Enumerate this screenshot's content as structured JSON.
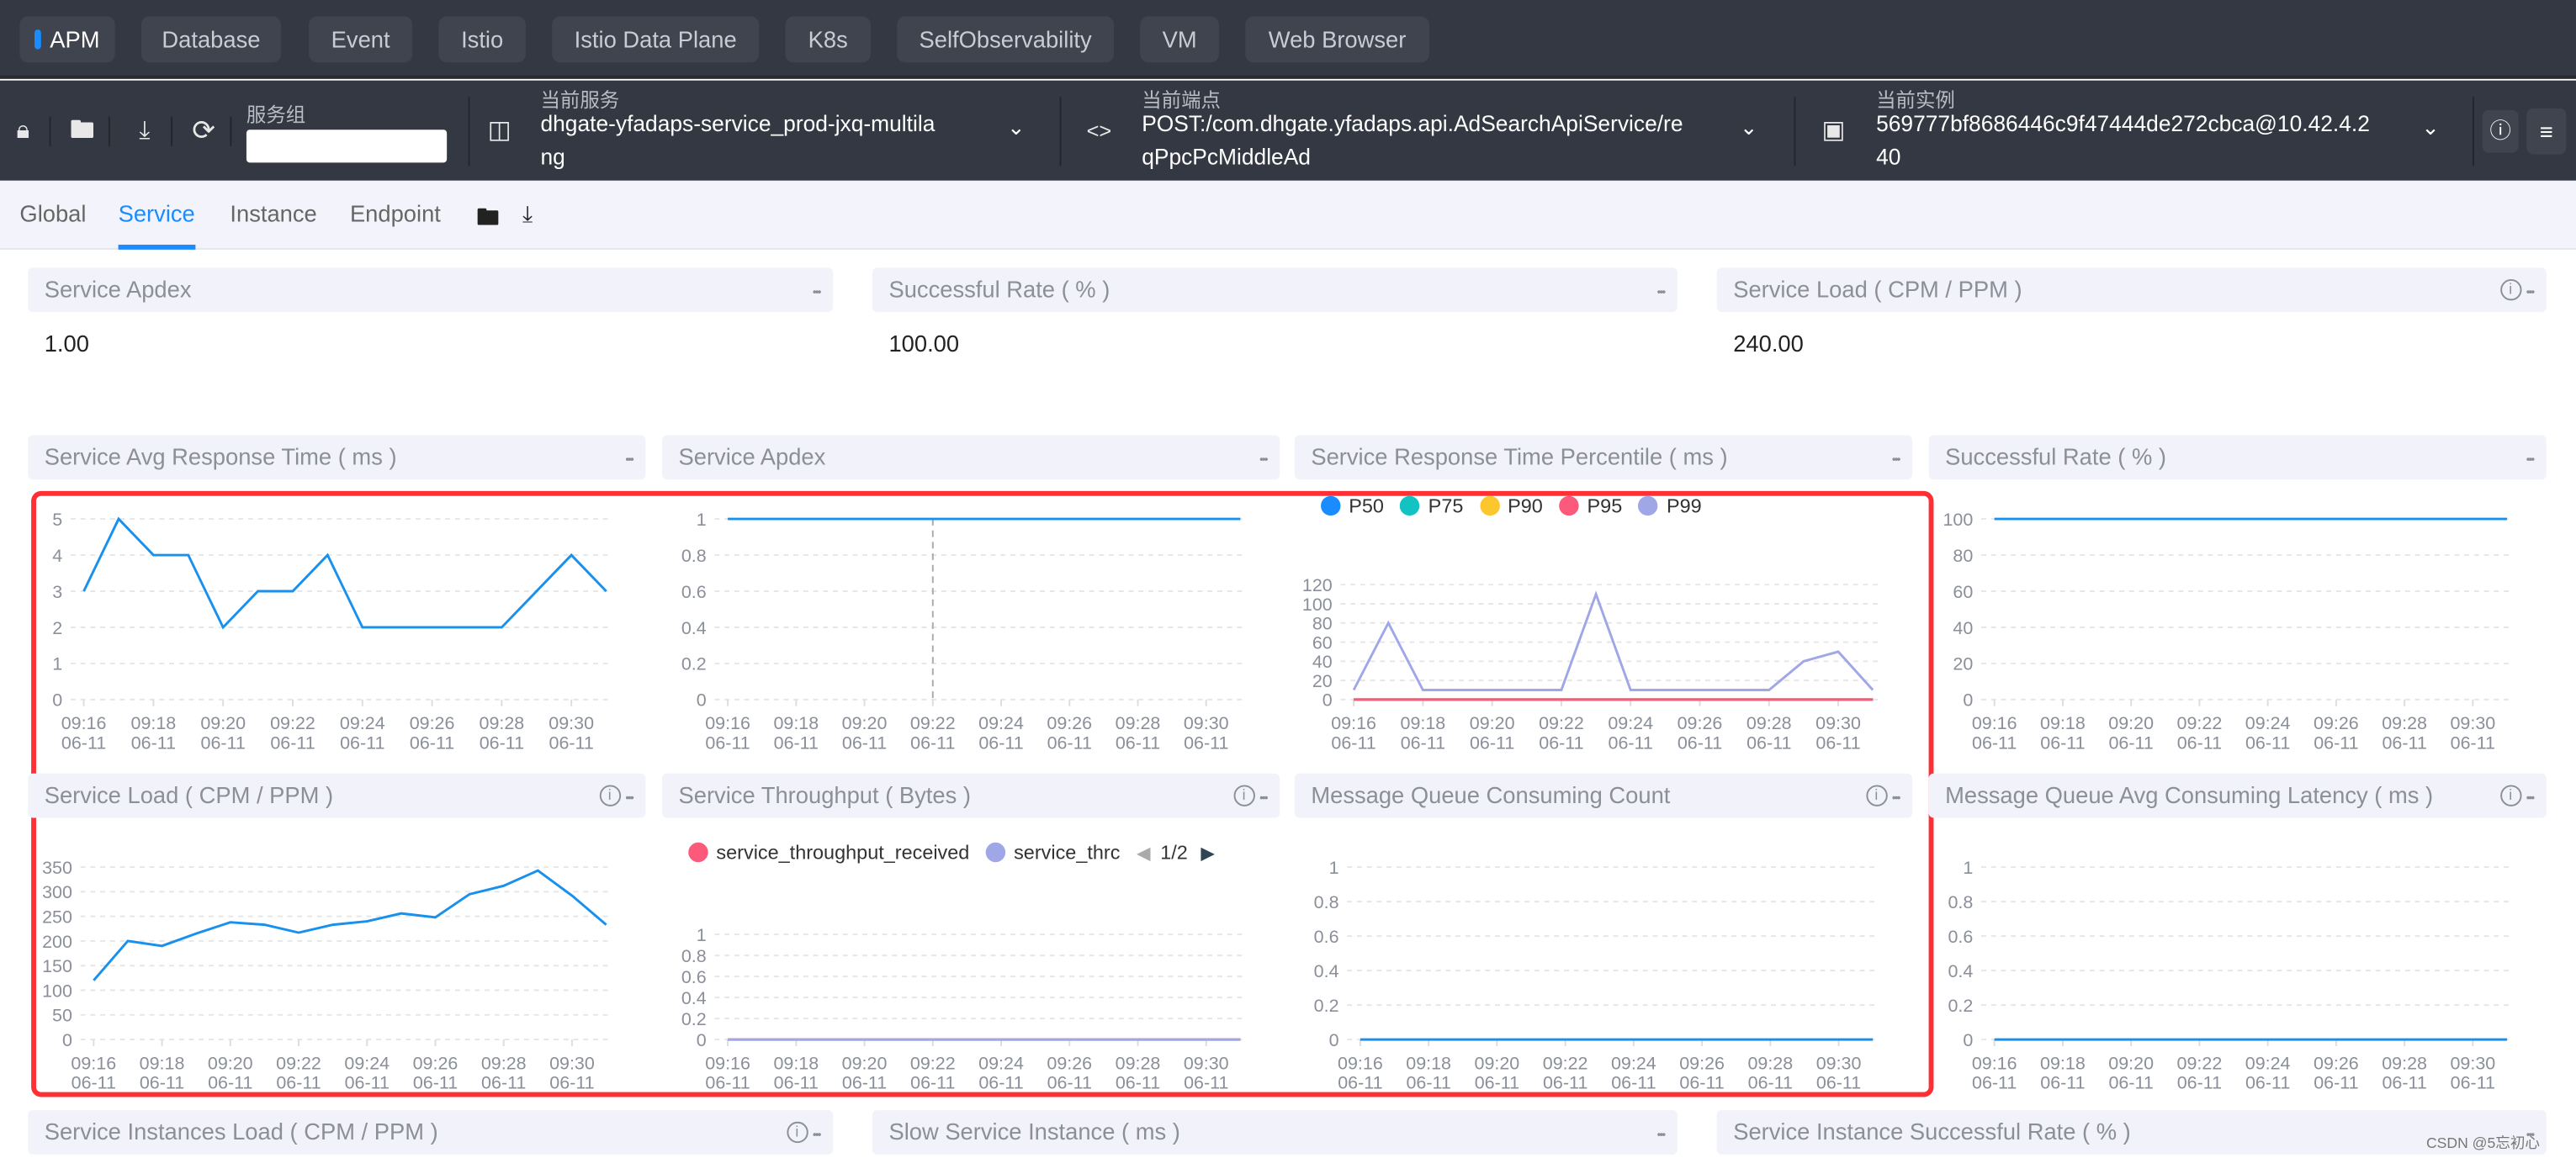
{
  "nav": {
    "items": [
      "APM",
      "Database",
      "Event",
      "Istio",
      "Istio Data Plane",
      "K8s",
      "SelfObservability",
      "VM",
      "Web Browser"
    ],
    "active": "APM"
  },
  "toolbar": {
    "service_group_label": "服务组",
    "service_group_value": "",
    "service_label": "当前服务",
    "service_value": [
      "dhgate-yfadaps-service_prod-jxq-multila",
      "ng"
    ],
    "endpoint_label": "当前端点",
    "endpoint_value": [
      "POST:/com.dhgate.yfadaps.api.AdSearchApiService/re",
      "qPpcPcMiddleAd"
    ],
    "instance_label": "当前实例",
    "instance_value": [
      "569777bf8686446c9f47444de272cbca@10.42.4.2",
      "40"
    ]
  },
  "tabs": [
    "Global",
    "Service",
    "Instance",
    "Endpoint"
  ],
  "active_tab": "Service",
  "cards": [
    {
      "title": "Service Apdex",
      "value": "1.00",
      "info": false
    },
    {
      "title": "Successful Rate ( % )",
      "value": "100.00",
      "info": false
    },
    {
      "title": "Service Load ( CPM / PPM )",
      "value": "240.00",
      "info": true
    }
  ],
  "bottom_headers": [
    {
      "title": "Service Instances Load ( CPM / PPM )",
      "info": true
    },
    {
      "title": "Slow Service Instance ( ms )",
      "info": false
    },
    {
      "title": "Service Instance Successful Rate ( % )",
      "info": false
    }
  ],
  "watermark": "CSDN @5忘初心",
  "colors": {
    "accent": "#1a8cff",
    "line": "#1890ee",
    "highlight_box": "#ff3035"
  },
  "chart_data": [
    {
      "type": "line",
      "title": "Service Avg Response Time ( ms )",
      "info": false,
      "ylim": [
        0,
        5
      ],
      "yticks": [
        0,
        1,
        2,
        3,
        4,
        5
      ],
      "x": [
        "09:16",
        "09:17",
        "09:18",
        "09:19",
        "09:20",
        "09:21",
        "09:22",
        "09:23",
        "09:24",
        "09:25",
        "09:26",
        "09:27",
        "09:28",
        "09:29",
        "09:30",
        "09:31"
      ],
      "xtick_labels": [
        "09:16",
        "09:18",
        "09:20",
        "09:22",
        "09:24",
        "09:26",
        "09:28",
        "09:30"
      ],
      "xtick_date": "06-11",
      "series": [
        {
          "color": "#1890ee",
          "values": [
            3,
            5,
            4,
            4,
            2,
            3,
            3,
            4,
            2,
            2,
            2,
            2,
            2,
            3,
            4,
            3
          ]
        }
      ]
    },
    {
      "type": "line",
      "title": "Service Apdex",
      "info": false,
      "ylim": [
        0,
        1
      ],
      "yticks": [
        0,
        0.2,
        0.4,
        0.6,
        0.8,
        1
      ],
      "crosshair": "09:22",
      "x": [
        "09:16",
        "09:17",
        "09:18",
        "09:19",
        "09:20",
        "09:21",
        "09:22",
        "09:23",
        "09:24",
        "09:25",
        "09:26",
        "09:27",
        "09:28",
        "09:29",
        "09:30",
        "09:31"
      ],
      "xtick_labels": [
        "09:16",
        "09:18",
        "09:20",
        "09:22",
        "09:24",
        "09:26",
        "09:28",
        "09:30"
      ],
      "xtick_date": "06-11",
      "series": [
        {
          "color": "#1890ee",
          "values": [
            1,
            1,
            1,
            1,
            1,
            1,
            1,
            1,
            1,
            1,
            1,
            1,
            1,
            1,
            1,
            1
          ]
        }
      ]
    },
    {
      "type": "line",
      "title": "Service Response Time Percentile ( ms )",
      "info": false,
      "ylim": [
        0,
        120
      ],
      "yticks": [
        0,
        20,
        40,
        60,
        80,
        100,
        120
      ],
      "x": [
        "09:16",
        "09:17",
        "09:18",
        "09:19",
        "09:20",
        "09:21",
        "09:22",
        "09:23",
        "09:24",
        "09:25",
        "09:26",
        "09:27",
        "09:28",
        "09:29",
        "09:30",
        "09:31"
      ],
      "xtick_labels": [
        "09:16",
        "09:18",
        "09:20",
        "09:22",
        "09:24",
        "09:26",
        "09:28",
        "09:30"
      ],
      "xtick_date": "06-11",
      "legend": "top-left",
      "series": [
        {
          "name": "P50",
          "color": "#1a8cff",
          "values": [
            0,
            0,
            0,
            0,
            0,
            0,
            0,
            0,
            0,
            0,
            0,
            0,
            0,
            0,
            0,
            0
          ]
        },
        {
          "name": "P75",
          "color": "#13c2c2",
          "values": [
            0,
            0,
            0,
            0,
            0,
            0,
            0,
            0,
            0,
            0,
            0,
            0,
            0,
            0,
            0,
            0
          ]
        },
        {
          "name": "P90",
          "color": "#fcc62e",
          "values": [
            0,
            0,
            0,
            0,
            0,
            0,
            0,
            0,
            0,
            0,
            0,
            0,
            0,
            0,
            0,
            0
          ]
        },
        {
          "name": "P95",
          "color": "#fc5a7a",
          "values": [
            0,
            0,
            0,
            0,
            0,
            0,
            0,
            0,
            0,
            0,
            0,
            0,
            0,
            0,
            0,
            0
          ]
        },
        {
          "name": "P99",
          "color": "#a0a7e6",
          "values": [
            10,
            80,
            10,
            10,
            10,
            10,
            10,
            110,
            10,
            10,
            10,
            10,
            10,
            40,
            50,
            10
          ]
        }
      ]
    },
    {
      "type": "line",
      "title": "Successful Rate ( % )",
      "info": false,
      "ylim": [
        0,
        100
      ],
      "yticks": [
        0,
        20,
        40,
        60,
        80,
        100
      ],
      "x": [
        "09:16",
        "09:17",
        "09:18",
        "09:19",
        "09:20",
        "09:21",
        "09:22",
        "09:23",
        "09:24",
        "09:25",
        "09:26",
        "09:27",
        "09:28",
        "09:29",
        "09:30",
        "09:31"
      ],
      "xtick_labels": [
        "09:16",
        "09:18",
        "09:20",
        "09:22",
        "09:24",
        "09:26",
        "09:28",
        "09:30"
      ],
      "xtick_date": "06-11",
      "series": [
        {
          "color": "#1890ee",
          "values": [
            100,
            100,
            100,
            100,
            100,
            100,
            100,
            100,
            100,
            100,
            100,
            100,
            100,
            100,
            100,
            100
          ]
        }
      ]
    },
    {
      "type": "line",
      "title": "Service Load ( CPM / PPM )",
      "info": true,
      "ylim": [
        0,
        350
      ],
      "yticks": [
        0,
        50,
        100,
        150,
        200,
        250,
        300,
        350
      ],
      "x": [
        "09:16",
        "09:17",
        "09:18",
        "09:19",
        "09:20",
        "09:21",
        "09:22",
        "09:23",
        "09:24",
        "09:25",
        "09:26",
        "09:27",
        "09:28",
        "09:29",
        "09:30",
        "09:31"
      ],
      "xtick_labels": [
        "09:16",
        "09:18",
        "09:20",
        "09:22",
        "09:24",
        "09:26",
        "09:28",
        "09:30"
      ],
      "xtick_date": "06-11",
      "series": [
        {
          "color": "#1890ee",
          "values": [
            120,
            200,
            190,
            215,
            238,
            233,
            217,
            233,
            240,
            256,
            248,
            295,
            312,
            343,
            292,
            233
          ]
        }
      ]
    },
    {
      "type": "line",
      "title": "Service Throughput ( Bytes )",
      "info": true,
      "ylim": [
        0,
        1
      ],
      "yticks": [
        0,
        0.2,
        0.4,
        0.6,
        0.8,
        1
      ],
      "x": [
        "09:16",
        "09:17",
        "09:18",
        "09:19",
        "09:20",
        "09:21",
        "09:22",
        "09:23",
        "09:24",
        "09:25",
        "09:26",
        "09:27",
        "09:28",
        "09:29",
        "09:30",
        "09:31"
      ],
      "xtick_labels": [
        "09:16",
        "09:18",
        "09:20",
        "09:22",
        "09:24",
        "09:26",
        "09:28",
        "09:30"
      ],
      "xtick_date": "06-11",
      "legend": "top-left",
      "legend_page": "1/2",
      "series": [
        {
          "name": "service_throughput_received",
          "color": "#fc5a7a",
          "values": [
            0,
            0,
            0,
            0,
            0,
            0,
            0,
            0,
            0,
            0,
            0,
            0,
            0,
            0,
            0,
            0
          ]
        },
        {
          "name": "service_thrc",
          "color": "#a0a7e6",
          "values": [
            0,
            0,
            0,
            0,
            0,
            0,
            0,
            0,
            0,
            0,
            0,
            0,
            0,
            0,
            0,
            0
          ]
        }
      ]
    },
    {
      "type": "line",
      "title": "Message Queue Consuming Count",
      "info": true,
      "ylim": [
        0,
        1
      ],
      "yticks": [
        0,
        0.2,
        0.4,
        0.6,
        0.8,
        1
      ],
      "x": [
        "09:16",
        "09:17",
        "09:18",
        "09:19",
        "09:20",
        "09:21",
        "09:22",
        "09:23",
        "09:24",
        "09:25",
        "09:26",
        "09:27",
        "09:28",
        "09:29",
        "09:30",
        "09:31"
      ],
      "xtick_labels": [
        "09:16",
        "09:18",
        "09:20",
        "09:22",
        "09:24",
        "09:26",
        "09:28",
        "09:30"
      ],
      "xtick_date": "06-11",
      "series": [
        {
          "color": "#1890ee",
          "values": [
            0,
            0,
            0,
            0,
            0,
            0,
            0,
            0,
            0,
            0,
            0,
            0,
            0,
            0,
            0,
            0
          ]
        }
      ]
    },
    {
      "type": "line",
      "title": "Message Queue Avg Consuming Latency ( ms )",
      "info": true,
      "ylim": [
        0,
        1
      ],
      "yticks": [
        0,
        0.2,
        0.4,
        0.6,
        0.8,
        1
      ],
      "x": [
        "09:16",
        "09:17",
        "09:18",
        "09:19",
        "09:20",
        "09:21",
        "09:22",
        "09:23",
        "09:24",
        "09:25",
        "09:26",
        "09:27",
        "09:28",
        "09:29",
        "09:30",
        "09:31"
      ],
      "xtick_labels": [
        "09:16",
        "09:18",
        "09:20",
        "09:22",
        "09:24",
        "09:26",
        "09:28",
        "09:30"
      ],
      "xtick_date": "06-11",
      "series": [
        {
          "color": "#1890ee",
          "values": [
            0,
            0,
            0,
            0,
            0,
            0,
            0,
            0,
            0,
            0,
            0,
            0,
            0,
            0,
            0,
            0
          ]
        }
      ]
    }
  ]
}
